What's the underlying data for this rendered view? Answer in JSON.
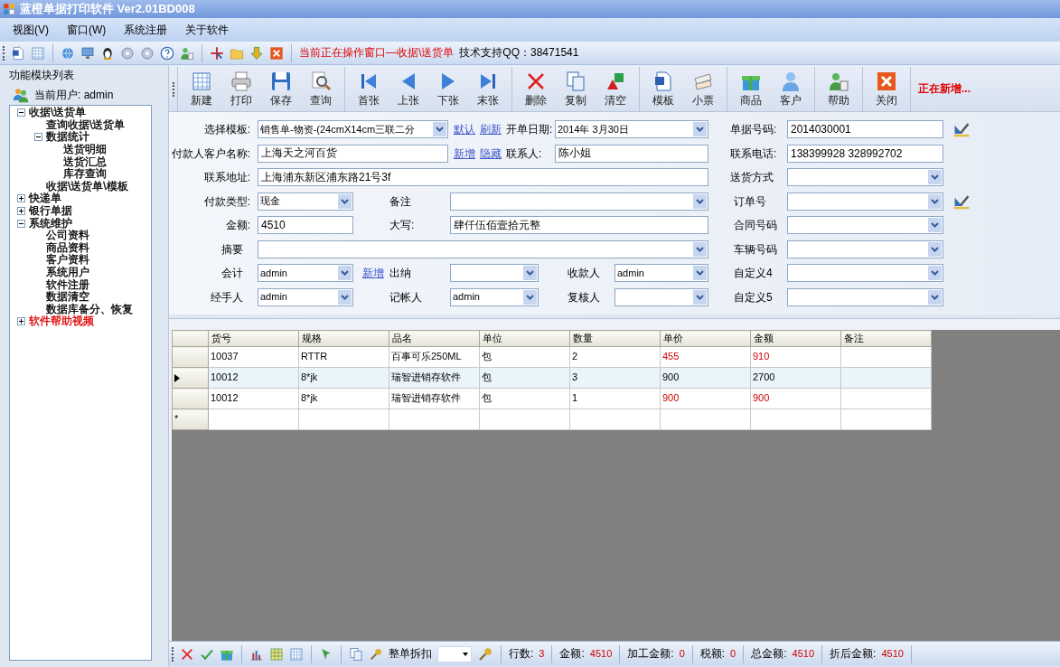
{
  "window": {
    "title": "蓝橙单据打印软件 Ver2.01BD008"
  },
  "menu": [
    "视图(V)",
    "窗口(W)",
    "系统注册",
    "关于软件"
  ],
  "quick_toolbar": {
    "current_window": "当前正在操作窗口—收据\\送货单",
    "support": "技术支持QQ：38471541"
  },
  "sidebar": {
    "title": "功能模块列表",
    "user": "当前用户: admin",
    "tree": [
      {
        "label": "收据\\送货单",
        "expanded": true,
        "children": [
          {
            "label": "查询收据\\送货单"
          },
          {
            "label": "数据统计",
            "expanded": true,
            "children": [
              {
                "label": "送货明细"
              },
              {
                "label": "送货汇总"
              },
              {
                "label": "库存查询"
              }
            ]
          },
          {
            "label": "收据\\送货单\\模板"
          }
        ]
      },
      {
        "label": "快递单",
        "expanded": false
      },
      {
        "label": "银行单据",
        "expanded": false
      },
      {
        "label": "系统维护",
        "expanded": true,
        "children": [
          {
            "label": "公司资料"
          },
          {
            "label": "商品资料"
          },
          {
            "label": "客户资料"
          },
          {
            "label": "系统用户"
          },
          {
            "label": "软件注册"
          },
          {
            "label": "数据清空"
          },
          {
            "label": "数据库备分、恢复"
          }
        ]
      },
      {
        "label": "软件帮助视频",
        "expanded": false,
        "color": "#e00000"
      }
    ]
  },
  "toolbar": {
    "groups": [
      [
        "新建",
        "打印",
        "保存",
        "查询"
      ],
      [
        "首张",
        "上张",
        "下张",
        "末张"
      ],
      [
        "删除",
        "复制",
        "清空"
      ],
      [
        "模板",
        "小票"
      ],
      [
        "商品",
        "客户"
      ],
      [
        "帮助"
      ],
      [
        "关闭"
      ]
    ],
    "status": "正在新增..."
  },
  "form": {
    "rows": [
      [
        {
          "kind": "label",
          "text": "选择模板:"
        },
        {
          "kind": "combo",
          "value": "销售单-物资-(24cmX14cm三联二分"
        },
        {
          "kind": "link",
          "text": "默认"
        },
        {
          "kind": "link",
          "text": "刷新"
        },
        {
          "kind": "label",
          "text": "开单日期:"
        },
        {
          "kind": "combo",
          "value": "2014年  3月30日"
        }
      ],
      [
        {
          "kind": "label",
          "text": "付款人客户名称:"
        },
        {
          "kind": "text",
          "value": "上海天之河百货"
        },
        {
          "kind": "link",
          "text": "新增"
        },
        {
          "kind": "link",
          "text": "隐藏"
        },
        {
          "kind": "label",
          "text": "联系人:"
        },
        {
          "kind": "text",
          "value": "陈小姐"
        }
      ],
      [
        {
          "kind": "label",
          "text": "联系地址:"
        },
        {
          "kind": "text",
          "value": "上海浦东新区浦东路21号3f"
        }
      ],
      [
        {
          "kind": "label",
          "text": "付款类型:"
        },
        {
          "kind": "combo",
          "value": "现金"
        },
        {
          "kind": "label",
          "text": "备注"
        },
        {
          "kind": "combo"
        }
      ],
      [
        {
          "kind": "label",
          "text": "金额:"
        },
        {
          "kind": "text",
          "value": "4510"
        },
        {
          "kind": "label",
          "text": "大写:"
        },
        {
          "kind": "text",
          "value": "肆仟伍佰壹拾元整"
        }
      ],
      [
        {
          "kind": "label",
          "text": "摘要"
        },
        {
          "kind": "combo"
        }
      ],
      [
        {
          "kind": "label",
          "text": "会计"
        },
        {
          "kind": "combo",
          "value": "admin",
          "link": "新增"
        },
        {
          "kind": "label",
          "text": "出纳"
        },
        {
          "kind": "combo"
        },
        {
          "kind": "label",
          "text": "收款人"
        },
        {
          "kind": "combo",
          "value": "admin"
        }
      ],
      [
        {
          "kind": "label",
          "text": "经手人"
        },
        {
          "kind": "combo",
          "value": "admin"
        },
        {
          "kind": "label",
          "text": "记帐人"
        },
        {
          "kind": "combo",
          "value": "admin"
        },
        {
          "kind": "label",
          "text": "复核人"
        },
        {
          "kind": "combo"
        }
      ]
    ],
    "side_fields": [
      [
        {
          "kind": "label",
          "text": "单据号码:"
        },
        {
          "kind": "text",
          "value": "2014030001"
        },
        {
          "kind": "picker"
        }
      ],
      [
        {
          "kind": "label",
          "text": "联系电话:"
        },
        {
          "kind": "text",
          "value": "138399928 328992702"
        }
      ],
      [
        {
          "kind": "label",
          "text": "送货方式"
        },
        {
          "kind": "combo"
        }
      ],
      [
        {
          "kind": "label",
          "text": "订单号"
        },
        {
          "kind": "combo"
        },
        {
          "kind": "picker"
        }
      ],
      [
        {
          "kind": "label",
          "text": "合同号码"
        },
        {
          "kind": "combo"
        }
      ],
      [
        {
          "kind": "label",
          "text": "车辆号码"
        },
        {
          "kind": "combo"
        }
      ],
      [
        {
          "kind": "label",
          "text": "自定义4"
        },
        {
          "kind": "combo"
        }
      ],
      [
        {
          "kind": "label",
          "text": "自定义5"
        },
        {
          "kind": "combo"
        }
      ]
    ]
  },
  "grid": {
    "columns": [
      "货号",
      "规格",
      "品名",
      "单位",
      "数量",
      "单价",
      "金额",
      "备注"
    ],
    "rows": [
      {
        "cells": [
          "10037",
          "RTTR",
          "百事可乐250ML",
          "包",
          "2",
          "455",
          "910"
        ],
        "selected": false,
        "price_alert": true
      },
      {
        "cells": [
          "10012",
          "8*jk",
          "瑞智进销存软件",
          "包",
          "3",
          "900",
          "2700"
        ],
        "selected": true,
        "price_alert": false
      },
      {
        "cells": [
          "10012",
          "8*jk",
          "瑞智进销存软件",
          "包",
          "1",
          "900",
          "900"
        ],
        "selected": false,
        "price_alert": true
      }
    ],
    "new_row_marker": "*"
  },
  "bottom_bar": {
    "discount_label": "整单拆扣",
    "stats": [
      {
        "label": "行数:",
        "value": "3"
      },
      {
        "label": "金额:",
        "value": "4510"
      },
      {
        "label": "加工金额:",
        "value": "0"
      },
      {
        "label": "税额:",
        "value": "0"
      },
      {
        "label": "总金额:",
        "value": "4510"
      },
      {
        "label": "折后金额:",
        "value": "4510"
      }
    ]
  }
}
